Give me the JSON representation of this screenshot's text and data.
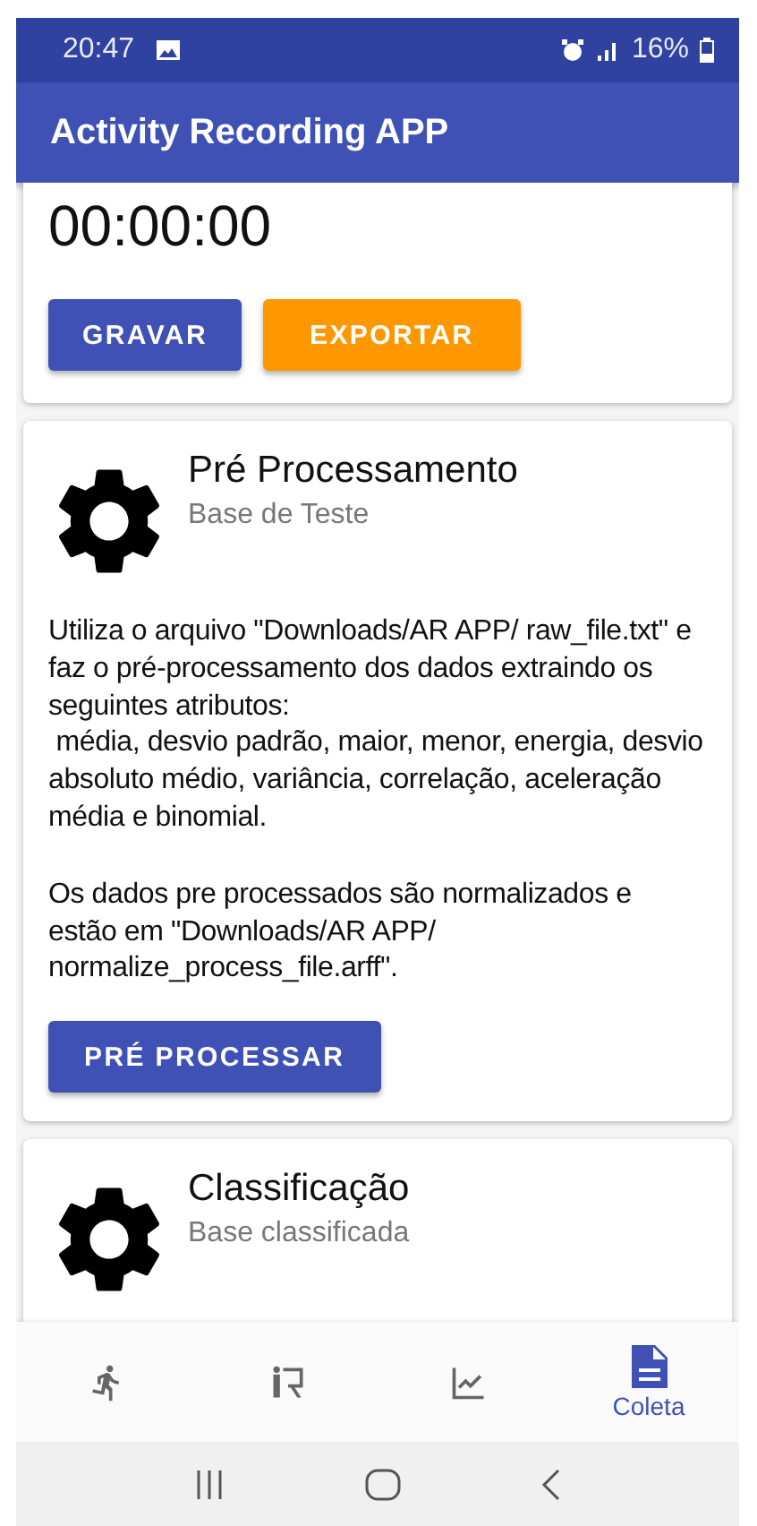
{
  "status_bar": {
    "time": "20:47",
    "battery": "16%"
  },
  "app_bar": {
    "title": "Activity Recording APP"
  },
  "timer_card": {
    "time": "00:00:00",
    "buttons": [
      {
        "label": "GRAVAR",
        "kind": "primary"
      },
      {
        "label": "EXPORTAR",
        "kind": "accent"
      }
    ]
  },
  "cards": [
    {
      "title": "Pré Processamento",
      "subtitle": "Base de Teste",
      "paragraphs": [
        "Utiliza o arquivo \"Downloads/AR APP/ raw_file.txt\" e faz o pré-processamento dos dados extraindo os seguintes atributos:\n média, desvio padrão, maior, menor, energia, desvio absoluto médio, variância, correlação, aceleração média e binomial.",
        "Os dados pre processados são normalizados e estão em \"Downloads/AR APP/ normalize_process_file.arff\"."
      ],
      "button": "PRÉ PROCESSAR"
    },
    {
      "title": "Classificação",
      "subtitle": "Base classificada"
    }
  ],
  "bottom_nav": [
    {
      "kind": "run",
      "selected": false
    },
    {
      "kind": "teach",
      "selected": false
    },
    {
      "kind": "chart",
      "selected": false
    },
    {
      "kind": "document",
      "label": "Coleta",
      "selected": true
    }
  ]
}
